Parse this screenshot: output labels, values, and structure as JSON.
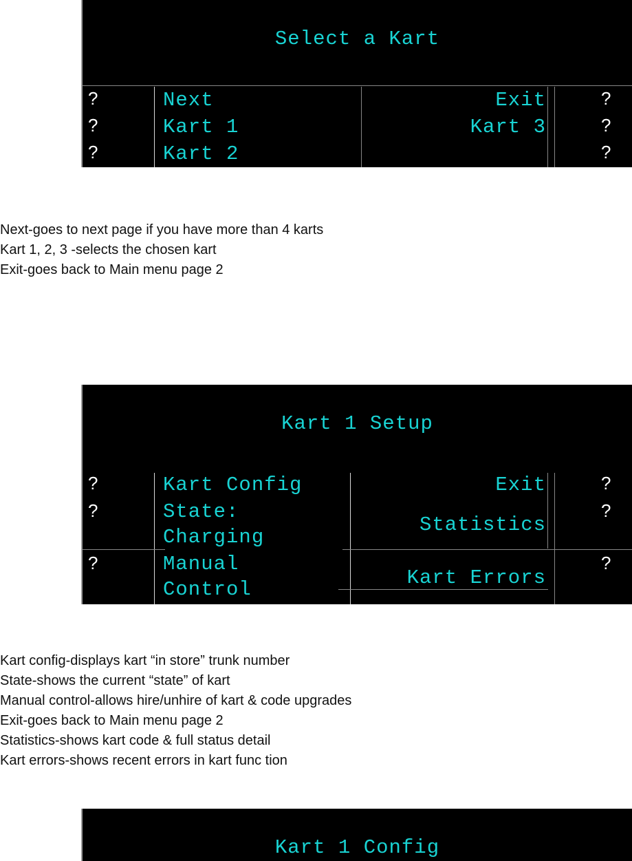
{
  "screens": [
    {
      "title": "Select a Kart",
      "left_buttons": [
        "Next",
        "Kart 1",
        "Kart 2"
      ],
      "right_buttons": [
        "Exit",
        "Kart 3",
        ""
      ],
      "key_glyph": "?"
    },
    {
      "title": "Kart 1 Setup",
      "left_buttons": [
        "Kart Config",
        "State:\nCharging",
        "Manual\nControl"
      ],
      "right_buttons": [
        "Exit",
        "Statistics",
        "Kart Errors"
      ],
      "key_glyph": "?"
    },
    {
      "title": "Kart 1 Config"
    }
  ],
  "descriptions": [
    [
      "Next-goes to next page if you have more than 4 karts",
      "Kart 1, 2, 3 -selects the chosen kart",
      "Exit-goes back to Main menu page 2"
    ],
    [
      "Kart config-displays kart “in store” trunk number",
      "State-shows the current “state” of kart",
      "Manual control-allows hire/unhire of kart & code upgrades",
      "Exit-goes back to Main menu page 2",
      "Statistics-shows kart code & full status detail",
      "Kart errors-shows recent errors in kart func tion"
    ]
  ],
  "colors": {
    "screen_bg": "#000000",
    "screen_text": "#19d3d3",
    "key_glyph": "#ffffff"
  }
}
